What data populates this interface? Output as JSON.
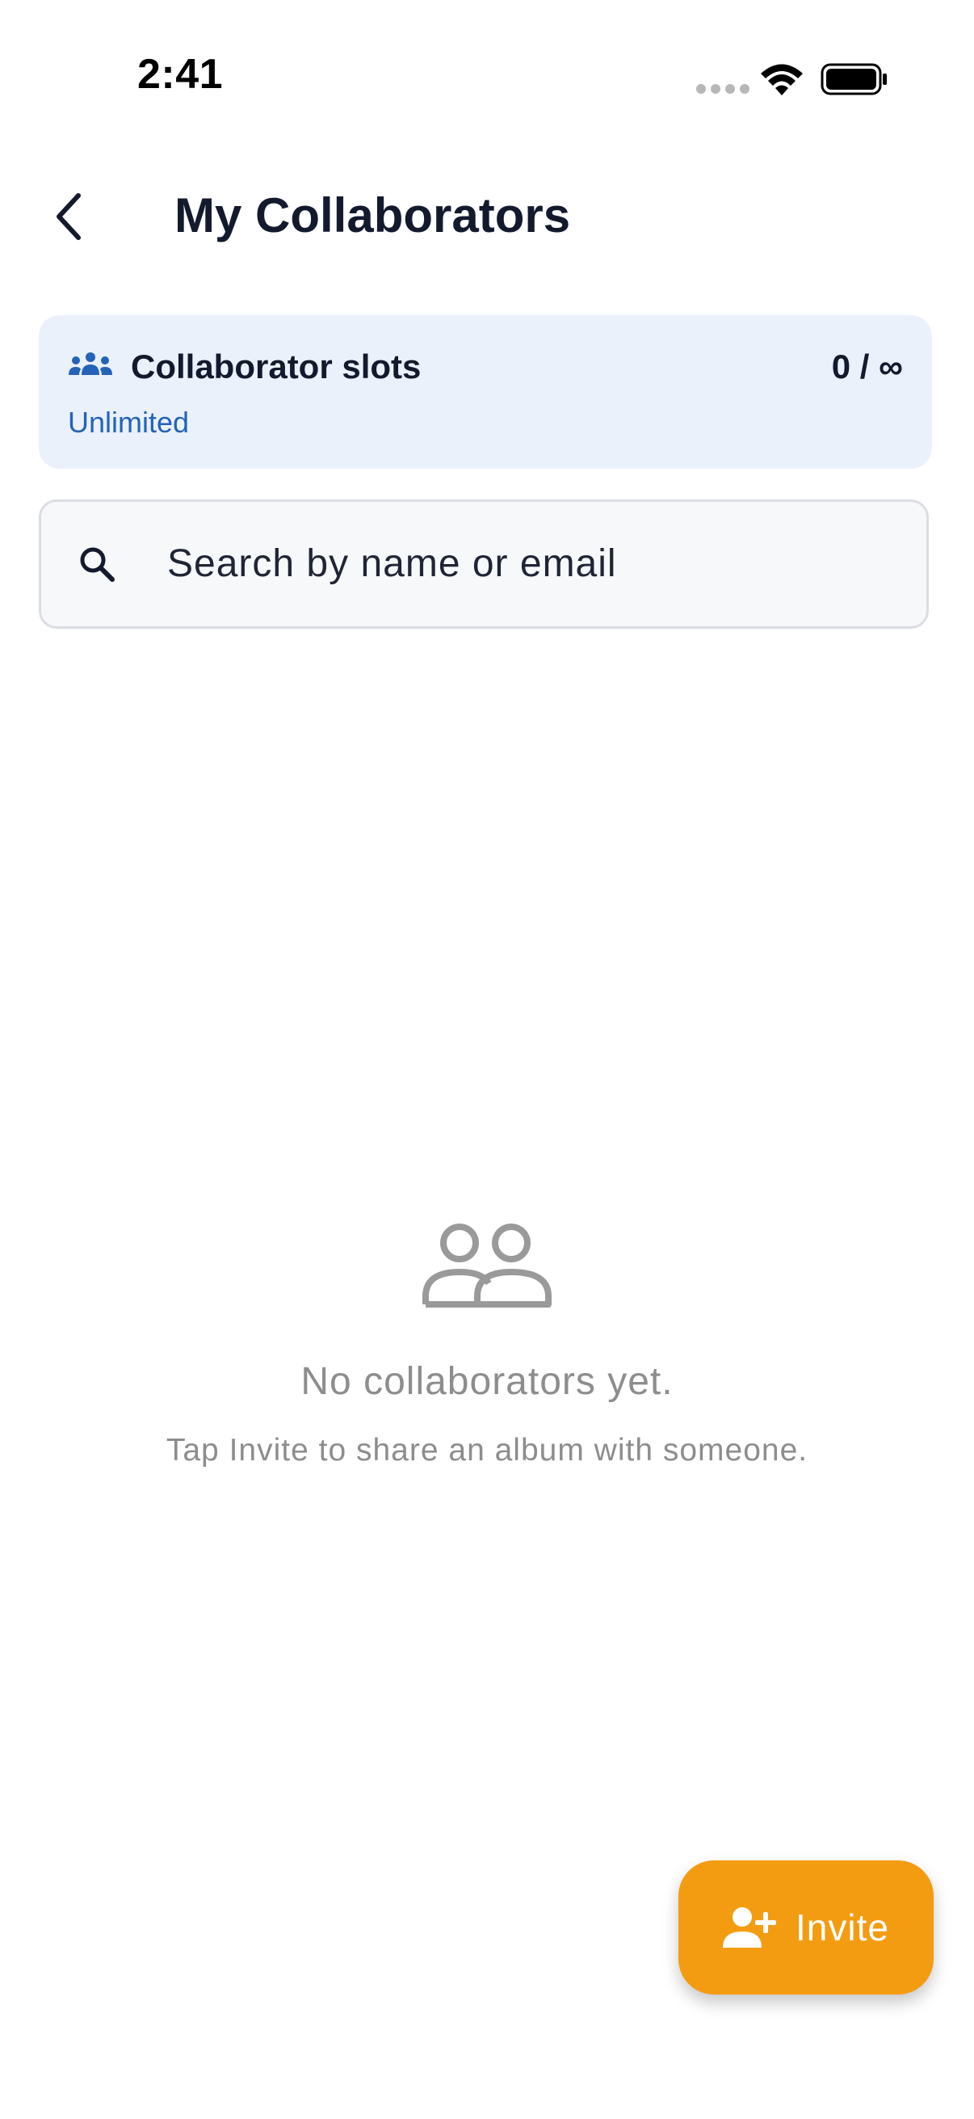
{
  "status_bar": {
    "time": "2:41"
  },
  "header": {
    "title": "My Collaborators",
    "back_icon": "chevron-left-icon"
  },
  "slots_card": {
    "icon": "group-icon",
    "title": "Collaborator slots",
    "count": "0 / ∞",
    "subtitle": "Unlimited"
  },
  "search": {
    "icon": "search-icon",
    "placeholder": "Search by name or email",
    "value": ""
  },
  "empty_state": {
    "icon": "people-outline-icon",
    "title": "No collaborators yet.",
    "subtitle": "Tap Invite to share an album with someone."
  },
  "fab": {
    "icon": "person-add-icon",
    "label": "Invite"
  },
  "colors": {
    "accent": "#f39c12",
    "slots_card_bg": "#eaf1fb",
    "slots_link": "#2463b8",
    "text_primary": "#141a2e",
    "text_muted": "#8d8d8d"
  }
}
